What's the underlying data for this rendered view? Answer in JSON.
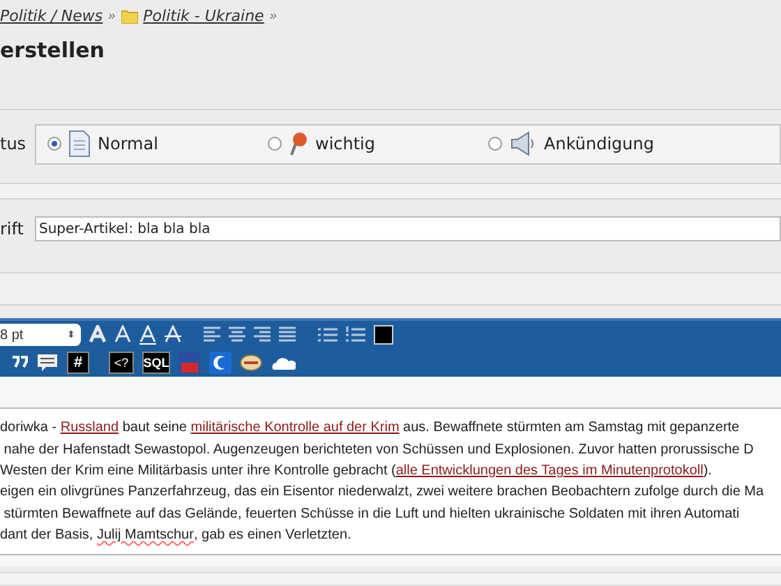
{
  "breadcrumb": [
    {
      "label": "Politik / News",
      "folder": false,
      "separator": "»"
    },
    {
      "label": "Politik - Ukraine",
      "folder": true,
      "separator": "»"
    }
  ],
  "heading": "erstellen",
  "status": {
    "label": "tus",
    "options": [
      {
        "label": "Normal",
        "selected": true,
        "kind": "page"
      },
      {
        "label": "wichtig",
        "selected": false,
        "kind": "pin"
      },
      {
        "label": "Ankündigung",
        "selected": false,
        "kind": "speaker"
      }
    ]
  },
  "title_field": {
    "label": "rift",
    "value": "Super-Artikel: bla bla bla"
  },
  "toolbar": {
    "font_size": "8 pt",
    "select_arrows": "⬍",
    "hash": "#",
    "code": "<?",
    "sql": "SQL"
  },
  "editor_lines": [
    [
      {
        "kind": "text",
        "text": "doriwka - "
      },
      {
        "kind": "link",
        "text": "Russland"
      },
      {
        "kind": "text",
        "text": " baut seine "
      },
      {
        "kind": "link",
        "text": "militärische Kontrolle auf der Krim"
      },
      {
        "kind": "text",
        "text": " aus. Bewaffnete stürmten am Samstag mit gepanzerte"
      }
    ],
    [
      {
        "kind": "text",
        "text": " nahe der Hafenstadt Sewastopol. Augenzeugen berichteten von Schüssen und Explosionen. Zuvor hatten prorussische D"
      }
    ],
    [
      {
        "kind": "text",
        "text": "Westen der Krim eine Militärbasis unter ihre Kontrolle gebracht ("
      },
      {
        "kind": "link",
        "text": "alle Entwicklungen des Tages im Minutenprotokoll"
      },
      {
        "kind": "text",
        "text": ")."
      }
    ],
    [
      {
        "kind": "text",
        "text": "eigen ein olivgrünes Panzerfahrzeug, das ein Eisentor niederwalzt, zwei weitere brachen Beobachtern zufolge durch die Ma"
      }
    ],
    [
      {
        "kind": "text",
        "text": " stürmten Bewaffnete auf das Gelände, feuerten Schüsse in die Luft und hielten ukrainische Soldaten mit ihren Automati"
      }
    ],
    [
      {
        "kind": "text",
        "text": "dant der Basis, "
      },
      {
        "kind": "spell",
        "text": "Julij Mamtschur"
      },
      {
        "kind": "text",
        "text": ", gab es einen Verletzten."
      }
    ]
  ]
}
